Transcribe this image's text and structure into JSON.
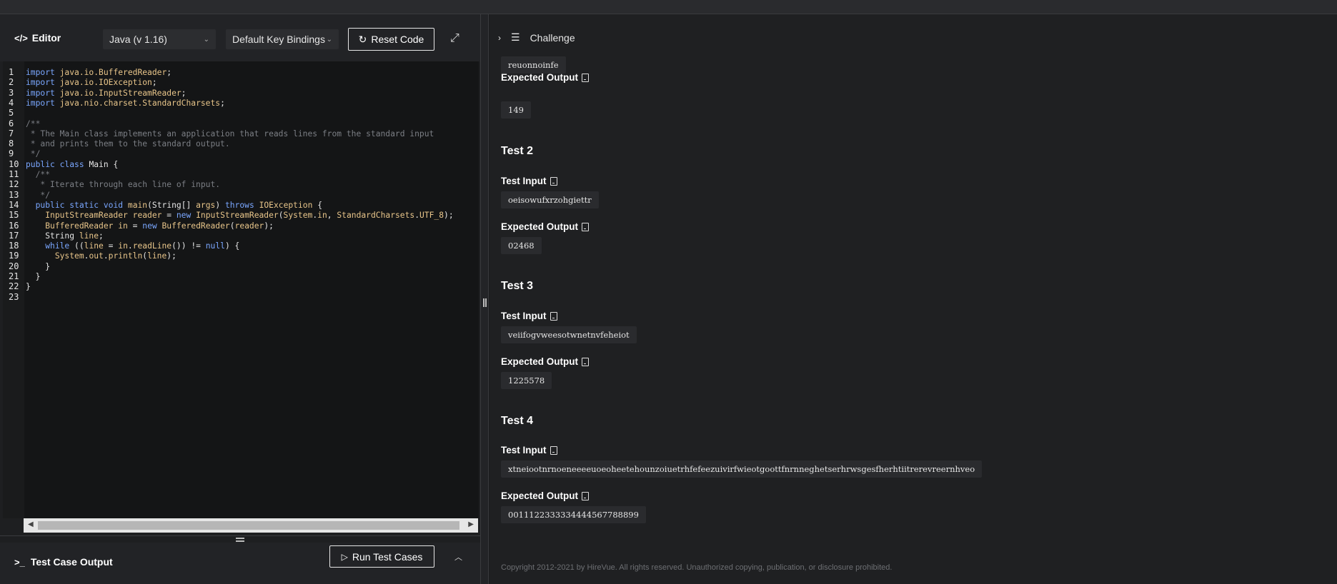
{
  "editor": {
    "title": "Editor",
    "language": "Java (v 1.16)",
    "keybindings": "Default Key Bindings",
    "reset_label": "Reset Code"
  },
  "code_lines": [
    "import java.io.BufferedReader;",
    "import java.io.IOException;",
    "import java.io.InputStreamReader;",
    "import java.nio.charset.StandardCharsets;",
    "",
    "/**",
    " * The Main class implements an application that reads lines from the standard input",
    " * and prints them to the standard output.",
    " */",
    "public class Main {",
    "  /**",
    "   * Iterate through each line of input.",
    "   */",
    "  public static void main(String[] args) throws IOException {",
    "    InputStreamReader reader = new InputStreamReader(System.in, StandardCharsets.UTF_8);",
    "    BufferedReader in = new BufferedReader(reader);",
    "    String line;",
    "    while ((line = in.readLine()) != null) {",
    "      System.out.println(line);",
    "    }",
    "  }",
    "}",
    ""
  ],
  "output_bar": {
    "title": "Test Case Output",
    "run_label": "Run Test Cases"
  },
  "challenge": {
    "title": "Challenge",
    "input_label": "Test Input",
    "output_label": "Expected Output",
    "first_partial": {
      "input": "reuonnoinfe",
      "expected": "149"
    },
    "tests": [
      {
        "name": "Test 2",
        "input": "oeisowufxrzohgiettr",
        "expected": "02468"
      },
      {
        "name": "Test 3",
        "input": "veiifogvweesotwnetnvfeheiot",
        "expected": "1225578"
      },
      {
        "name": "Test 4",
        "input": "xtneiootnrnoeneeeeuoeoheetehounzoiuetrhfefeezuivirfwieotgoottfnrnneghetserhrwsgesfherhtiitrerevreernhveo",
        "expected": "0011122333334444567788899"
      }
    ],
    "copyright": "Copyright 2012-2021 by HireVue. All rights reserved. Unauthorized copying, publication, or disclosure prohibited."
  }
}
